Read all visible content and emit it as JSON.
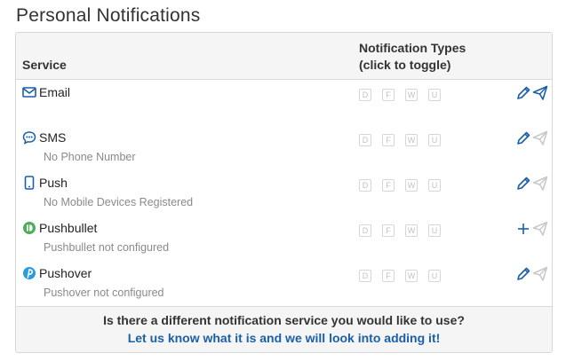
{
  "page_title": "Personal Notifications",
  "table": {
    "col_service": "Service",
    "col_types_line1": "Notification Types",
    "col_types_line2": "(click to toggle)"
  },
  "type_letters": [
    "D",
    "F",
    "W",
    "U"
  ],
  "services": [
    {
      "name": "Email",
      "sub": "",
      "icon": "envelope-icon",
      "action": "edit",
      "send_enabled": true
    },
    {
      "name": "SMS",
      "sub": "No Phone Number",
      "icon": "chat-bubble-icon",
      "action": "edit",
      "send_enabled": false
    },
    {
      "name": "Push",
      "sub": "No Mobile Devices Registered",
      "icon": "mobile-phone-icon",
      "action": "edit",
      "send_enabled": false
    },
    {
      "name": "Pushbullet",
      "sub": "Pushbullet not configured",
      "icon": "pushbullet-icon",
      "action": "add",
      "send_enabled": false
    },
    {
      "name": "Pushover",
      "sub": "Pushover not configured",
      "icon": "pushover-icon",
      "action": "edit",
      "send_enabled": false
    }
  ],
  "footer": {
    "question": "Is there a different notification service you would like to use?",
    "link": "Let us know what it is and we will look into adding it!"
  },
  "colors": {
    "accent": "#1a5fa8",
    "disabled": "#c8c8c8",
    "pushbullet_green": "#4cae5a",
    "pushover_blue": "#2a9bde"
  }
}
